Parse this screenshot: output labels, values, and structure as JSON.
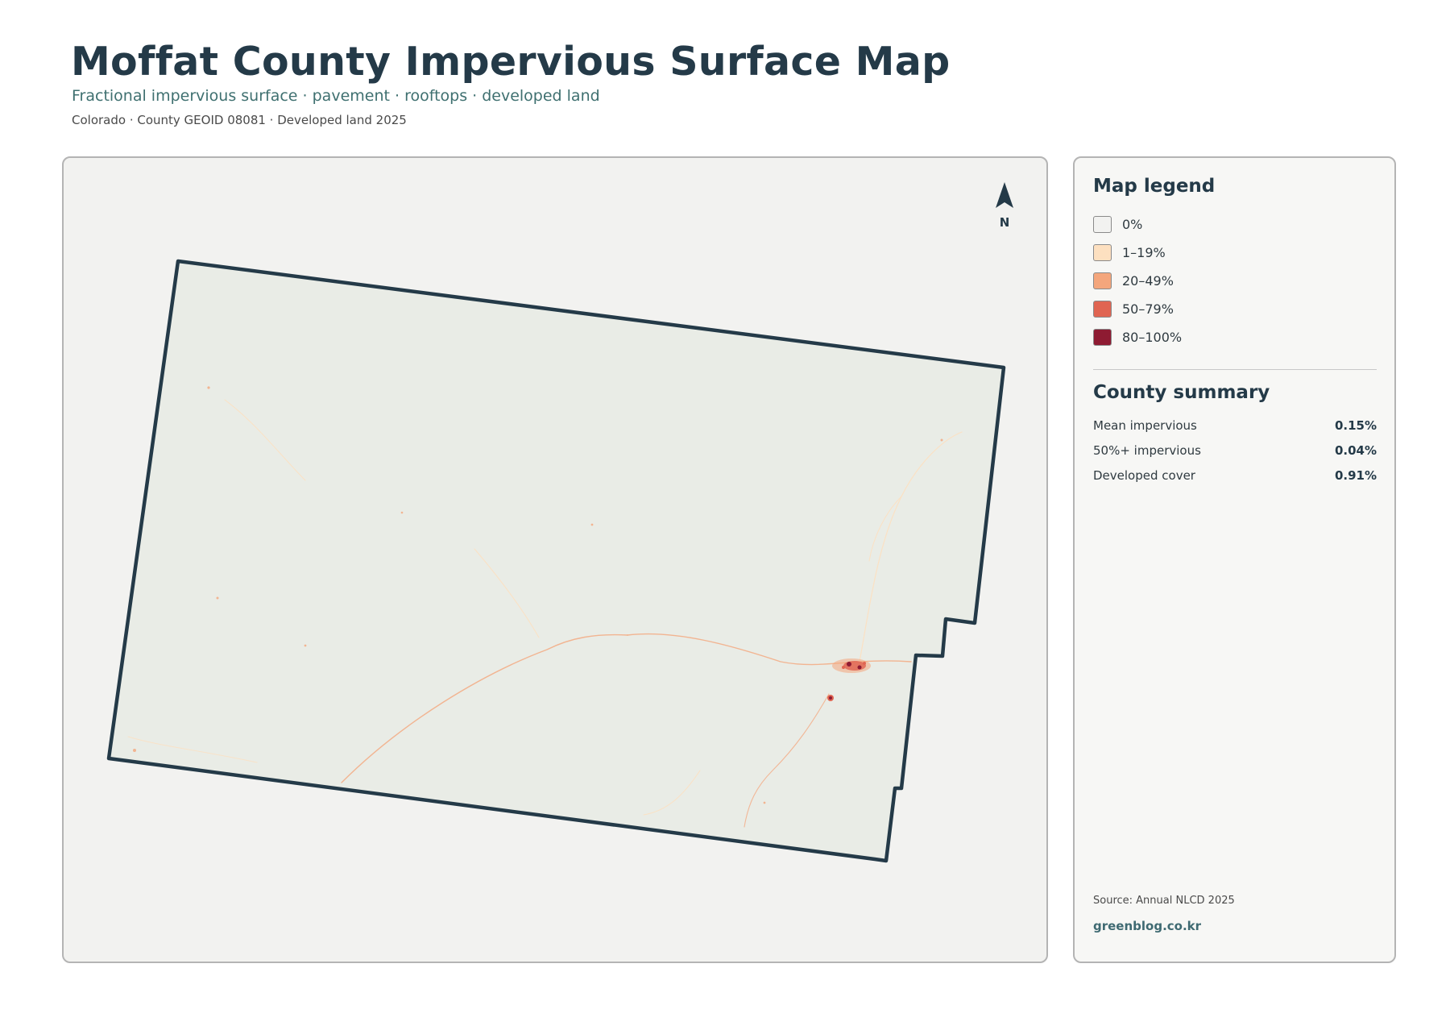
{
  "header": {
    "title": "Moffat County Impervious Surface Map",
    "subtitle": "Fractional impervious surface · pavement · rooftops · developed land",
    "meta": "Colorado · County GEOID 08081 · Developed land 2025"
  },
  "map": {
    "north_label": "N",
    "icon": "north-arrow-icon",
    "colors": {
      "county_fill": "#e9ece6",
      "county_outline": "#243a48",
      "background": "#f2f2f0"
    }
  },
  "legend": {
    "title": "Map legend",
    "items": [
      {
        "label": "0%",
        "color": "#f2f2f0"
      },
      {
        "label": "1–19%",
        "color": "#fde0c0"
      },
      {
        "label": "20–49%",
        "color": "#f4a67c"
      },
      {
        "label": "50–79%",
        "color": "#e06552"
      },
      {
        "label": "80–100%",
        "color": "#8e1b32"
      }
    ]
  },
  "summary": {
    "title": "County summary",
    "rows": [
      {
        "label": "Mean impervious",
        "value": "0.15%"
      },
      {
        "label": "50%+ impervious",
        "value": "0.04%"
      },
      {
        "label": "Developed cover",
        "value": "0.91%"
      }
    ]
  },
  "footer": {
    "source": "Source: Annual NLCD 2025",
    "credit": "greenblog.co.kr"
  }
}
